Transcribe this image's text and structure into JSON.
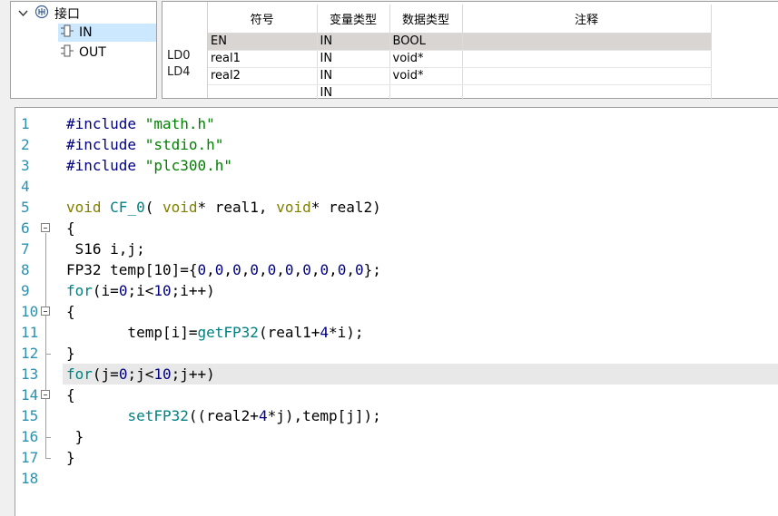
{
  "tree": {
    "root_label": "接口",
    "items": [
      {
        "label": "IN",
        "selected": true
      },
      {
        "label": "OUT",
        "selected": false
      }
    ]
  },
  "table": {
    "columns": [
      "符号",
      "变量类型",
      "数据类型",
      "注释"
    ],
    "side_labels": [
      "LD0",
      "LD4"
    ],
    "rows": [
      {
        "symbol": "EN",
        "var_type": "IN",
        "data_type": "BOOL",
        "comment": ""
      },
      {
        "symbol": "real1",
        "var_type": "IN",
        "data_type": "void*",
        "comment": ""
      },
      {
        "symbol": "real2",
        "var_type": "IN",
        "data_type": "void*",
        "comment": ""
      },
      {
        "symbol": "",
        "var_type": "IN",
        "data_type": "",
        "comment": ""
      }
    ]
  },
  "editor": {
    "line_numbers": [
      "1",
      "2",
      "3",
      "4",
      "5",
      "6",
      "7",
      "8",
      "9",
      "10",
      "11",
      "12",
      "13",
      "14",
      "15",
      "16",
      "17",
      "18"
    ],
    "highlighted_line": 13,
    "colors": {
      "keyword": "#0000ff",
      "type": "#808000",
      "string": "#008000",
      "number": "#000080",
      "function": "#008080",
      "line_number": "#2b91af"
    },
    "lines": [
      [
        [
          "pp",
          "#include "
        ],
        [
          "st",
          "\"math.h\""
        ]
      ],
      [
        [
          "pp",
          "#include "
        ],
        [
          "st",
          "\"stdio.h\""
        ]
      ],
      [
        [
          "pp",
          "#include "
        ],
        [
          "st",
          "\"plc300.h\""
        ]
      ],
      [],
      [
        [
          "ty",
          "void"
        ],
        [
          "op",
          " "
        ],
        [
          "fn",
          "CF_0"
        ],
        [
          "op",
          "( "
        ],
        [
          "ty",
          "void"
        ],
        [
          "op",
          "* real1, "
        ],
        [
          "ty",
          "void"
        ],
        [
          "op",
          "* real2)"
        ]
      ],
      [
        [
          "op",
          "{"
        ]
      ],
      [
        [
          "op",
          " S16 i,j;"
        ]
      ],
      [
        [
          "op",
          "FP32 temp[10]={"
        ],
        [
          "nm",
          "0"
        ],
        [
          "op",
          ","
        ],
        [
          "nm",
          "0"
        ],
        [
          "op",
          ","
        ],
        [
          "nm",
          "0"
        ],
        [
          "op",
          ","
        ],
        [
          "nm",
          "0"
        ],
        [
          "op",
          ","
        ],
        [
          "nm",
          "0"
        ],
        [
          "op",
          ","
        ],
        [
          "nm",
          "0"
        ],
        [
          "op",
          ","
        ],
        [
          "nm",
          "0"
        ],
        [
          "op",
          ","
        ],
        [
          "nm",
          "0"
        ],
        [
          "op",
          ","
        ],
        [
          "nm",
          "0"
        ],
        [
          "op",
          ","
        ],
        [
          "nm",
          "0"
        ],
        [
          "op",
          "};"
        ]
      ],
      [
        [
          "ctl",
          "for"
        ],
        [
          "op",
          "(i="
        ],
        [
          "nm",
          "0"
        ],
        [
          "op",
          ";i<"
        ],
        [
          "nm",
          "10"
        ],
        [
          "op",
          ";i++)"
        ]
      ],
      [
        [
          "op",
          "{"
        ]
      ],
      [
        [
          "op",
          "       temp[i]="
        ],
        [
          "fn",
          "getFP32"
        ],
        [
          "op",
          "(real1+"
        ],
        [
          "nm",
          "4"
        ],
        [
          "op",
          "*i);"
        ]
      ],
      [
        [
          "op",
          "}"
        ]
      ],
      [
        [
          "ctl",
          "for"
        ],
        [
          "op",
          "(j="
        ],
        [
          "nm",
          "0"
        ],
        [
          "op",
          ";j<"
        ],
        [
          "nm",
          "10"
        ],
        [
          "op",
          ";j++)"
        ]
      ],
      [
        [
          "op",
          "{"
        ]
      ],
      [
        [
          "op",
          "       "
        ],
        [
          "fn",
          "setFP32"
        ],
        [
          "op",
          "((real2+"
        ],
        [
          "nm",
          "4"
        ],
        [
          "op",
          "*j),temp[j]);"
        ]
      ],
      [
        [
          "op",
          " }"
        ]
      ],
      [
        [
          "op",
          "}"
        ]
      ],
      []
    ]
  }
}
